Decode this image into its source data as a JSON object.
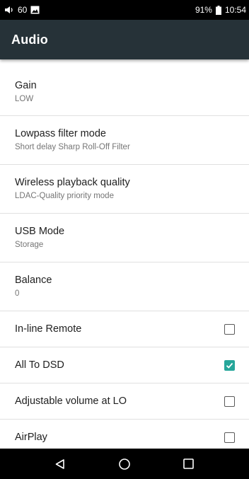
{
  "status_bar": {
    "volume_text": "60",
    "battery_percent": "91%",
    "time": "10:54",
    "icons": [
      "volume-icon",
      "image-notification-icon",
      "battery-icon"
    ]
  },
  "app_bar": {
    "title": "Audio"
  },
  "preferences": [
    {
      "title": "Gain",
      "summary": "LOW"
    },
    {
      "title": "Lowpass filter mode",
      "summary": "Short delay Sharp Roll-Off Filter"
    },
    {
      "title": "Wireless playback quality",
      "summary": "LDAC-Quality priority mode"
    },
    {
      "title": "USB Mode",
      "summary": "Storage"
    },
    {
      "title": "Balance",
      "summary": "0"
    }
  ],
  "checkbox_preferences": [
    {
      "title": "In-line Remote",
      "checked": false
    },
    {
      "title": "All To DSD",
      "checked": true
    },
    {
      "title": "Adjustable volume at LO",
      "checked": false
    },
    {
      "title": "AirPlay",
      "checked": false
    }
  ],
  "colors": {
    "app_bar": "#263238",
    "accent": "#26a69a",
    "status_bar": "#000000",
    "nav_bar": "#000000"
  },
  "nav_bar": {
    "icons": [
      "back-icon",
      "home-icon",
      "recents-icon"
    ]
  }
}
